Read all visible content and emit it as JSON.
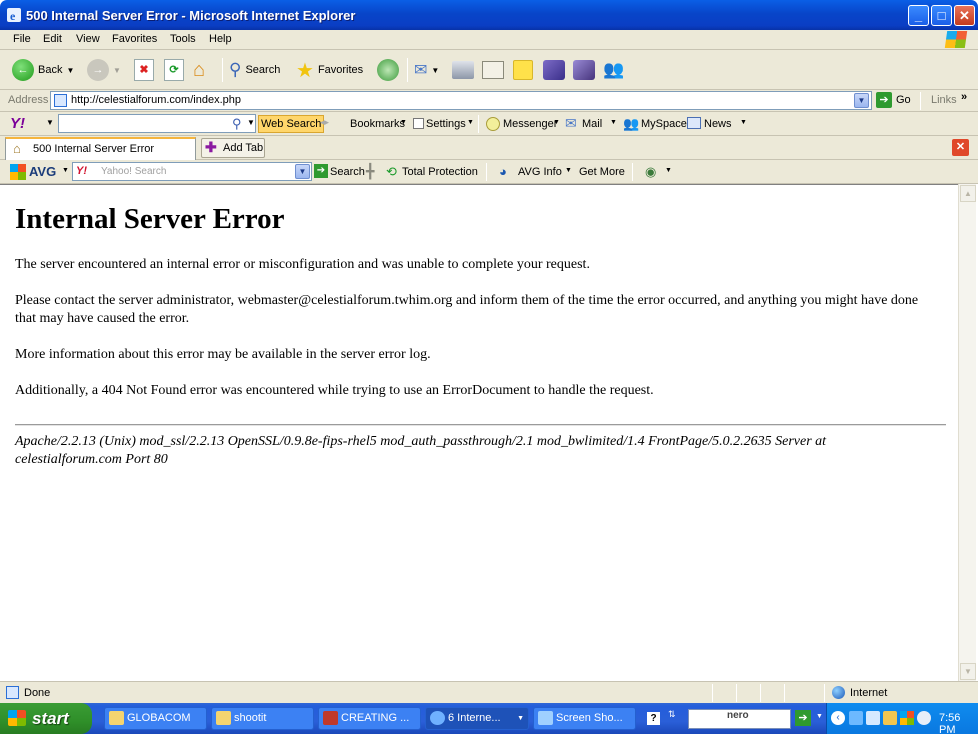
{
  "window": {
    "title": "500 Internal Server Error - Microsoft Internet Explorer"
  },
  "menu": [
    "File",
    "Edit",
    "View",
    "Favorites",
    "Tools",
    "Help"
  ],
  "toolbar": {
    "back_label": "Back",
    "search_label": "Search",
    "favorites_label": "Favorites"
  },
  "address": {
    "label": "Address",
    "url": "http://celestialforum.com/index.php",
    "go_label": "Go",
    "links_label": "Links"
  },
  "yahoo": {
    "search_button": "Web Search",
    "bookmarks": "Bookmarks",
    "settings": "Settings",
    "messenger": "Messenger",
    "mail": "Mail",
    "myspace": "MySpace",
    "news": "News"
  },
  "tabs": {
    "active_tab": "500 Internal Server Error",
    "add_tab": "Add Tab"
  },
  "avg": {
    "brand": "AVG",
    "search_placeholder": "Yahoo! Search",
    "search_label": "Search",
    "protection": "Total Protection",
    "info": "AVG Info",
    "get_more": "Get More"
  },
  "page": {
    "heading": "Internal Server Error",
    "p1": "The server encountered an internal error or misconfiguration and was unable to complete your request.",
    "p2": "Please contact the server administrator, webmaster@celestialforum.twhim.org and inform them of the time the error occurred, and anything you might have done that may have caused the error.",
    "p3": "More information about this error may be available in the server error log.",
    "p4": "Additionally, a 404 Not Found error was encountered while trying to use an ErrorDocument to handle the request.",
    "signature": "Apache/2.2.13 (Unix) mod_ssl/2.2.13 OpenSSL/0.9.8e-fips-rhel5 mod_auth_passthrough/2.1 mod_bwlimited/1.4 FrontPage/5.0.2.2635 Server at celestialforum.com Port 80"
  },
  "status": {
    "text": "Done",
    "zone": "Internet"
  },
  "taskbar": {
    "start": "start",
    "tasks": [
      "GLOBACOM",
      "shootit",
      "CREATING ...",
      "6 Interne...",
      "Screen Sho..."
    ],
    "clock": "7:56 PM",
    "nero": "nero"
  }
}
